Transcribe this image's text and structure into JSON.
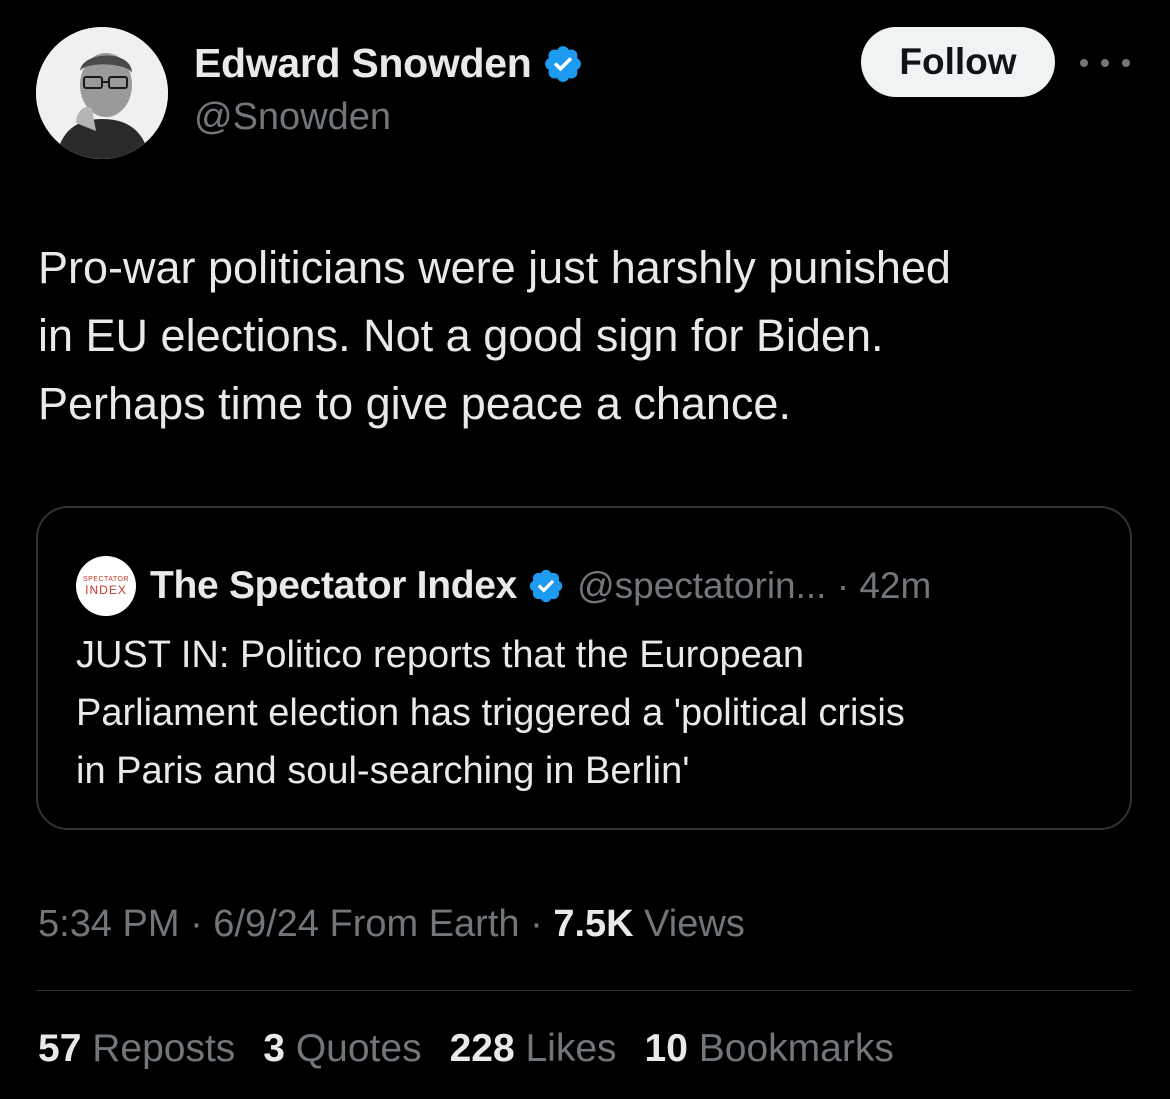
{
  "author": {
    "display_name": "Edward Snowden",
    "handle": "@Snowden",
    "verified": true,
    "avatar_icon": "person-photo-avatar"
  },
  "header": {
    "follow_label": "Follow",
    "more_icon": "ellipsis-icon"
  },
  "tweet": {
    "text": "Pro-war politicians were just harshly punished\nin EU elections. Not a good sign for Biden.\nPerhaps time to give peace a chance."
  },
  "quote": {
    "avatar_line1": "SPECTATOR",
    "avatar_line2": "INDEX",
    "name": "The Spectator Index",
    "handle_time": "@spectatorin... · 42m",
    "verified": true,
    "text": "JUST IN: Politico reports that the European\nParliament election has triggered a 'political crisis\nin Paris and soul-searching in Berlin'"
  },
  "meta": {
    "timestamp": "5:34 PM · 6/9/24 From Earth · ",
    "views_count": "7.5K",
    "views_label": " Views"
  },
  "stats": {
    "reposts_count": "57",
    "reposts_label": " Reposts",
    "quotes_count": "3",
    "quotes_label": " Quotes",
    "likes_count": "228",
    "likes_label": " Likes",
    "bookmarks_count": "10",
    "bookmarks_label": " Bookmarks"
  },
  "colors": {
    "background": "#000000",
    "primary_text": "#e7e9ea",
    "secondary_text": "#71767b",
    "border": "#2f3336",
    "verified_blue": "#1d9bf0",
    "follow_bg": "#eff3f4"
  }
}
